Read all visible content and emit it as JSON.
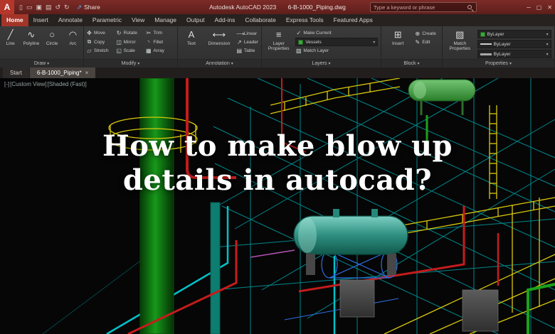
{
  "titlebar": {
    "logo_text": "A",
    "share_label": "Share",
    "app_title": "Autodesk AutoCAD 2023",
    "doc_title": "6-B-1000_Piping.dwg",
    "search_placeholder": "Type a keyword or phrase",
    "window_min": "─",
    "window_max": "▢",
    "window_close": "✕"
  },
  "ribbon": {
    "tabs": [
      "Home",
      "Insert",
      "Annotate",
      "Parametric",
      "View",
      "Manage",
      "Output",
      "Add-ins",
      "Collaborate",
      "Express Tools",
      "Featured Apps"
    ],
    "active_tab": "Home",
    "panels": {
      "draw": {
        "name": "Draw",
        "line": "Line",
        "polyline": "Polyline",
        "circle": "Circle",
        "arc": "Arc"
      },
      "modify": {
        "name": "Modify",
        "move": "Move",
        "rotate": "Rotate",
        "trim": "Trim",
        "copy": "Copy",
        "mirror": "Mirror",
        "fillet": "Fillet",
        "stretch": "Stretch",
        "scale": "Scale",
        "array": "Array"
      },
      "annotation": {
        "name": "Annotation",
        "text": "Text",
        "dimension": "Dimension",
        "linear": "Linear",
        "leader": "Leader",
        "table": "Table"
      },
      "layers": {
        "name": "Layers",
        "layer_properties": "Layer Properties",
        "make_current": "Make Current",
        "match_layer": "Match Layer",
        "current_layer": "Vessels"
      },
      "block": {
        "name": "Block",
        "insert": "Insert",
        "create": "Create",
        "edit": "Edit"
      },
      "properties": {
        "name": "Properties",
        "match_properties": "Match Properties",
        "color": "ByLayer",
        "linetype": "ByLayer",
        "lineweight": "ByLayer"
      }
    }
  },
  "icons": {
    "dropdown": "▾",
    "share": "⇗",
    "qat_new": "▯",
    "qat_open": "▭",
    "qat_save": "▣",
    "qat_plot": "▤",
    "qat_undo": "↺",
    "qat_redo": "↻",
    "line": "╱",
    "polyline": "∿",
    "circle": "○",
    "arc": "◠",
    "move": "✥",
    "rotate": "↻",
    "trim": "✂",
    "copy": "⧉",
    "mirror": "◫",
    "fillet": "◝",
    "stretch": "▱",
    "scale": "◱",
    "array": "▦",
    "text": "A",
    "dimension": "⟷",
    "linear": "⟶",
    "leader": "↗",
    "table": "▤",
    "layer_props": "≡",
    "make_current": "✓",
    "match_layer": "▧",
    "insert": "⊞",
    "create": "⊕",
    "edit": "✎",
    "match_props": "▨",
    "close_tab": "×"
  },
  "file_tabs": {
    "start": "Start",
    "drawing": "6-B-1000_Piping*"
  },
  "viewport": {
    "minus": "[-]",
    "view": "[Custom View]",
    "style": "[Shaded (Fast)]"
  },
  "overlay": {
    "title": "How to make blow up details in autocad?"
  },
  "colors": {
    "titlebar": "#6f2623",
    "active_tab": "#a33528",
    "layer_green": "#3da63d",
    "overlay_text": "#ffffff"
  }
}
